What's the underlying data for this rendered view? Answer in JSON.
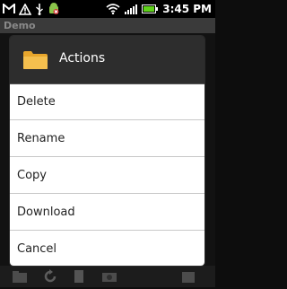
{
  "status_bar": {
    "time": "3:45 PM",
    "left_icons": [
      "gmail-icon",
      "warning-icon",
      "usb-icon",
      "android-debug-icon"
    ],
    "right_icons": [
      "wifi-icon",
      "signal-icon",
      "battery-icon"
    ]
  },
  "app": {
    "title": "Demo"
  },
  "dialog": {
    "title": "Actions",
    "icon": "folder-icon",
    "items": [
      {
        "label": "Delete"
      },
      {
        "label": "Rename"
      },
      {
        "label": "Copy"
      },
      {
        "label": "Download"
      },
      {
        "label": "Cancel"
      }
    ]
  },
  "colors": {
    "dialog_header": "#2d2d2d",
    "dialog_body": "#ffffff",
    "folder": "#f0b23a",
    "battery": "#5fd21a"
  }
}
